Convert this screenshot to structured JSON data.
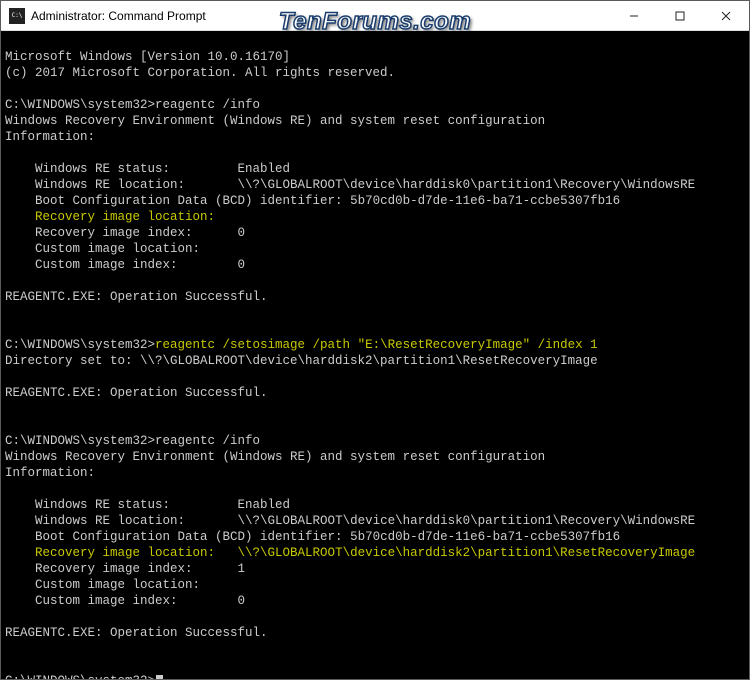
{
  "watermark": "TenForums.com",
  "titlebar": {
    "title": "Administrator: Command Prompt",
    "min": "—",
    "max": "▢",
    "close": "✕"
  },
  "header": {
    "l1": "Microsoft Windows [Version 10.0.16170]",
    "l2": "(c) 2017 Microsoft Corporation. All rights reserved."
  },
  "prompt_path": "C:\\WINDOWS\\system32>",
  "cmd1": "reagentc /info",
  "info_header": "Windows Recovery Environment (Windows RE) and system reset configuration",
  "info_label": "Information:",
  "block1": {
    "re_status_k": "    Windows RE status:         ",
    "re_status_v": "Enabled",
    "re_loc_k": "    Windows RE location:       ",
    "re_loc_v": "\\\\?\\GLOBALROOT\\device\\harddisk0\\partition1\\Recovery\\WindowsRE",
    "bcd_k": "    Boot Configuration Data (BCD) identifier: ",
    "bcd_v": "5b70cd0b-d7de-11e6-ba71-ccbe5307fb16",
    "rec_img_loc_k": "    Recovery image location:   ",
    "rec_img_loc_v": "",
    "rec_idx_k": "    Recovery image index:      ",
    "rec_idx_v": "0",
    "cust_loc_k": "    Custom image location:     ",
    "cust_loc_v": "",
    "cust_idx_k": "    Custom image index:        ",
    "cust_idx_v": "0"
  },
  "op_success": "REAGENTC.EXE: Operation Successful.",
  "cmd2": "reagentc /setosimage /path \"E:\\ResetRecoveryImage\" /index 1",
  "dir_set": "Directory set to: \\\\?\\GLOBALROOT\\device\\harddisk2\\partition1\\ResetRecoveryImage",
  "cmd3": "reagentc /info",
  "block2": {
    "re_status_k": "    Windows RE status:         ",
    "re_status_v": "Enabled",
    "re_loc_k": "    Windows RE location:       ",
    "re_loc_v": "\\\\?\\GLOBALROOT\\device\\harddisk0\\partition1\\Recovery\\WindowsRE",
    "bcd_k": "    Boot Configuration Data (BCD) identifier: ",
    "bcd_v": "5b70cd0b-d7de-11e6-ba71-ccbe5307fb16",
    "rec_img_loc_k": "    Recovery image location:   ",
    "rec_img_loc_v": "\\\\?\\GLOBALROOT\\device\\harddisk2\\partition1\\ResetRecoveryImage",
    "rec_idx_k": "    Recovery image index:      ",
    "rec_idx_v": "1",
    "cust_loc_k": "    Custom image location:     ",
    "cust_loc_v": "",
    "cust_idx_k": "    Custom image index:        ",
    "cust_idx_v": "0"
  }
}
